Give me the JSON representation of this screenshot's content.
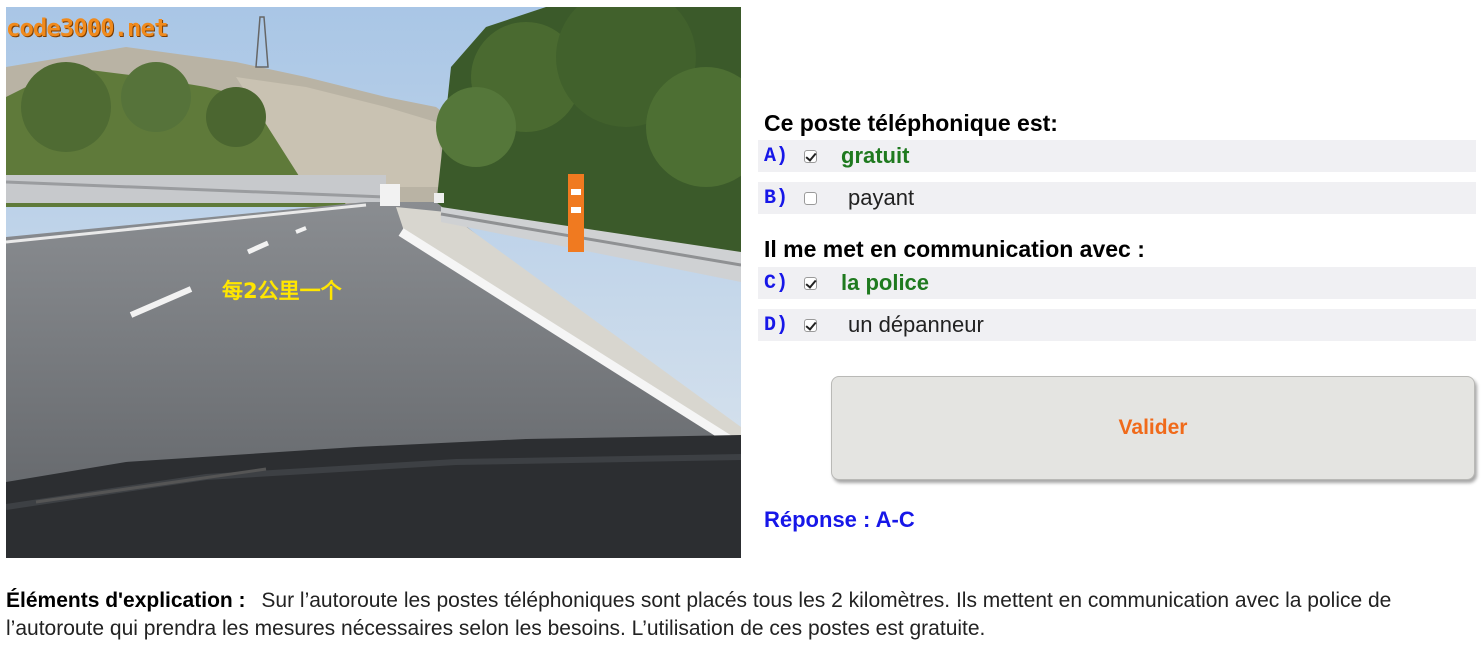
{
  "photo": {
    "watermark": "code3000.net",
    "overlay_note": "每2公里一个",
    "image_description_icon": "road-photo"
  },
  "questions": [
    {
      "title": "Ce poste téléphonique est:",
      "options": [
        {
          "letter": "A)",
          "text": "gratuit",
          "checked": true,
          "correct": true
        },
        {
          "letter": "B)",
          "text": "payant",
          "checked": false,
          "correct": false
        }
      ]
    },
    {
      "title": "Il me met en communication avec :",
      "options": [
        {
          "letter": "C)",
          "text": "la police",
          "checked": true,
          "correct": true
        },
        {
          "letter": "D)",
          "text": "un dépanneur",
          "checked": true,
          "correct": false
        }
      ]
    }
  ],
  "validate_label": "Valider",
  "answer": "Réponse : A-C",
  "explanation": {
    "label": "Éléments d'explication :",
    "text": "Sur l’autoroute les postes téléphoniques sont placés tous les 2 kilomètres. Ils mettent en communication avec la police de l’autoroute qui prendra les mesures nécessaires selon les besoins. L’utilisation de ces postes est gratuite."
  },
  "colors": {
    "letter": "#1717e8",
    "correct": "#1f7a1f",
    "validate_text": "#f06a1a",
    "answer": "#1717e8",
    "option_row_bg": "#f0f0f3"
  }
}
